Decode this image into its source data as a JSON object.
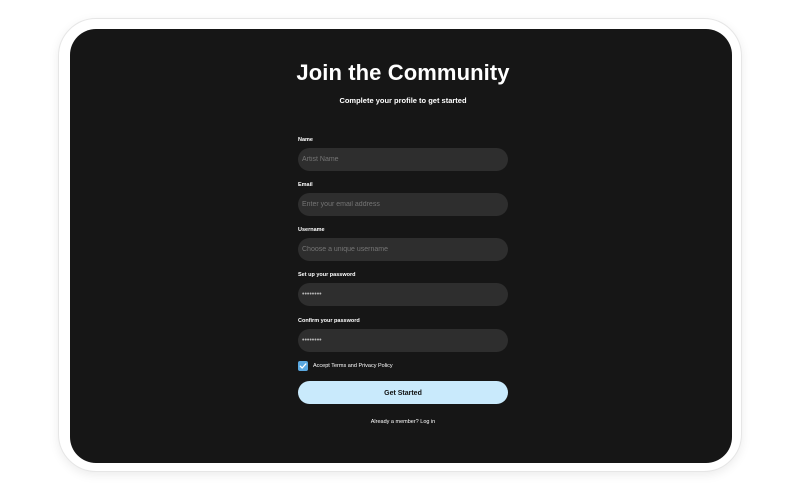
{
  "header": {
    "title": "Join the Community",
    "subtitle": "Complete your profile to get started"
  },
  "fields": {
    "name": {
      "label": "Name",
      "placeholder": "Artist Name"
    },
    "email": {
      "label": "Email",
      "placeholder": "Enter your email address"
    },
    "username": {
      "label": "Username",
      "placeholder": "Choose a unique username"
    },
    "password": {
      "label": "Set up your password",
      "value": "••••••••"
    },
    "confirm": {
      "label": "Confirm your password",
      "value": "••••••••"
    }
  },
  "terms": {
    "label": "Accept Terms and Privacy Policy",
    "checked": true
  },
  "submit": {
    "label": "Get Started"
  },
  "login": {
    "text": "Already a member? Log in"
  },
  "colors": {
    "background": "#161616",
    "field": "#2e2e2e",
    "accent_button": "#c9eafc",
    "checkbox": "#5aa8e0"
  },
  "icons": {
    "checkbox": "checkmark-icon"
  }
}
